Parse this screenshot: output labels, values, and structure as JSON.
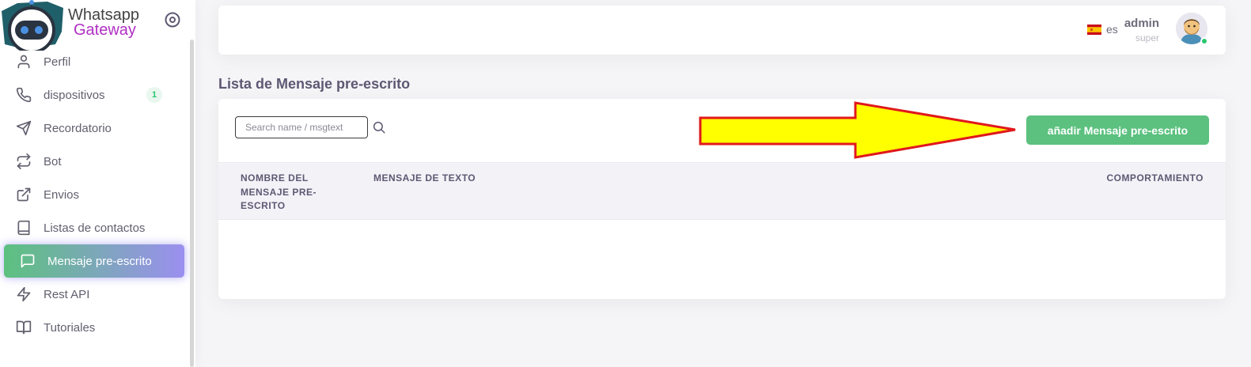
{
  "brand": {
    "line1": "Whatsapp",
    "line2": "Gateway"
  },
  "sidebar": {
    "items": [
      {
        "label": "Perfil",
        "icon": "user-icon"
      },
      {
        "label": "dispositivos",
        "icon": "phone-icon",
        "badge": "1"
      },
      {
        "label": "Recordatorio",
        "icon": "send-icon"
      },
      {
        "label": "Bot",
        "icon": "repeat-icon"
      },
      {
        "label": "Envios",
        "icon": "external-link-icon"
      },
      {
        "label": "Listas de contactos",
        "icon": "book-icon"
      },
      {
        "label": "Mensaje pre-escrito",
        "icon": "message-square-icon",
        "active": true
      },
      {
        "label": "Rest API",
        "icon": "zap-icon"
      },
      {
        "label": "Tutoriales",
        "icon": "book-open-icon"
      }
    ]
  },
  "navbar": {
    "language": "es",
    "user_name": "admin",
    "user_role": "super"
  },
  "page": {
    "title": "Lista de Mensaje pre-escrito"
  },
  "search": {
    "placeholder": "Search name / msgtext",
    "value": ""
  },
  "toolbar": {
    "add_label": "añadir Mensaje pre-escrito"
  },
  "table": {
    "columns": [
      "NOMBRE DEL MENSAJE PRE-ESCRITO",
      "MENSAJE DE TEXTO",
      "COMPORTAMIENTO"
    ],
    "rows": []
  },
  "colors": {
    "accent": "#5cc17f",
    "brand_purple": "#b02fc4",
    "arrow_fill": "#ffff00",
    "arrow_stroke": "#e0181c"
  }
}
